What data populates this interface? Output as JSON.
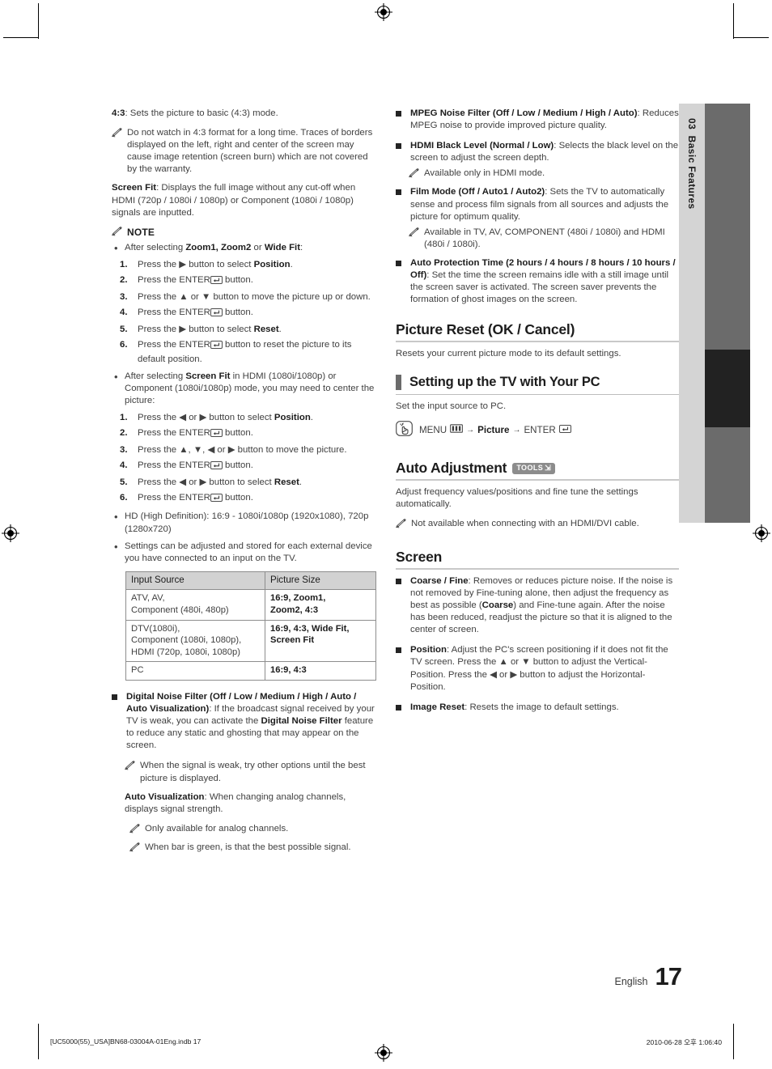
{
  "sidebar": {
    "chapter_number": "03",
    "chapter_title": "Basic Features"
  },
  "footer": {
    "language": "English",
    "page_number": "17",
    "print_file": "[UC5000(55)_USA]BN68-03004A-01Eng.indb   17",
    "print_timestamp": "2010-06-28   오후 1:06:40"
  },
  "left_column": {
    "ratio_43": {
      "term": "4:3",
      "desc": ": Sets the picture to basic (4:3) mode."
    },
    "note_43": "Do not watch in 4:3 format for a long time. Traces of borders displayed on the left, right and center of the screen may cause image retention (screen burn) which are not covered by the warranty.",
    "screen_fit": {
      "term": "Screen Fit",
      "desc": ": Displays the full image without any cut-off when HDMI (720p / 1080i / 1080p) or Component (1080i / 1080p) signals are inputted."
    },
    "note_label": "NOTE",
    "bullet1_intro_a": "After selecting ",
    "bullet1_intro_b": "Zoom1, Zoom2",
    "bullet1_intro_c": " or ",
    "bullet1_intro_d": "Wide Fit",
    "bullet1_intro_e": ":",
    "steps1": [
      {
        "num": "1.",
        "pre": "Press the ▶ button to select ",
        "bold": "Position",
        "post": "."
      },
      {
        "num": "2.",
        "pre": "Press the ENTER",
        "bold": "",
        "post": " button."
      },
      {
        "num": "3.",
        "pre": "Press the ▲ or ▼ button to move the picture up or down.",
        "bold": "",
        "post": ""
      },
      {
        "num": "4.",
        "pre": "Press the ENTER",
        "bold": "",
        "post": " button."
      },
      {
        "num": "5.",
        "pre": "Press the ▶ button to select ",
        "bold": "Reset",
        "post": "."
      },
      {
        "num": "6.",
        "pre": "Press the ENTER",
        "bold": "",
        "post": " button to reset the picture to its default position."
      }
    ],
    "bullet2_intro_a": "After selecting ",
    "bullet2_intro_b": "Screen Fit",
    "bullet2_intro_c": " in HDMI (1080i/1080p) or Component (1080i/1080p) mode, you may need to center the picture:",
    "steps2": [
      {
        "num": "1.",
        "pre": "Press the ◀ or ▶ button to select ",
        "bold": "Position",
        "post": "."
      },
      {
        "num": "2.",
        "pre": "Press the ENTER",
        "bold": "",
        "post": " button."
      },
      {
        "num": "3.",
        "pre": "Press the ▲, ▼, ◀ or ▶ button to move the picture.",
        "bold": "",
        "post": ""
      },
      {
        "num": "4.",
        "pre": "Press the ENTER",
        "bold": "",
        "post": " button."
      },
      {
        "num": "5.",
        "pre": "Press the ◀ or ▶ button to select ",
        "bold": "Reset",
        "post": "."
      },
      {
        "num": "6.",
        "pre": "Press the ENTER",
        "bold": "",
        "post": " button."
      }
    ],
    "bullet3": "HD (High Definition): 16:9 - 1080i/1080p (1920x1080), 720p (1280x720)",
    "bullet4": "Settings can be adjusted and stored for each external device you have connected to an input on the TV.",
    "table": {
      "headers": [
        "Input Source",
        "Picture Size"
      ],
      "rows": [
        {
          "source": "ATV, AV,\nComponent (480i, 480p)",
          "size": "16:9, Zoom1,\nZoom2, 4:3"
        },
        {
          "source": "DTV(1080i),\nComponent (1080i, 1080p),\nHDMI (720p, 1080i, 1080p)",
          "size": "16:9, 4:3, Wide Fit,\nScreen Fit"
        },
        {
          "source": "PC",
          "size": "16:9, 4:3"
        }
      ]
    },
    "digital_noise_filter": {
      "term": "Digital Noise Filter (Off / Low / Medium / High / Auto / Auto Visualization)",
      "desc_a": ": If the broadcast signal received by your TV is weak, you can activate the ",
      "term2": "Digital Noise Filter",
      "desc_b": " feature to reduce any static and ghosting that may appear on the screen.",
      "note": "When the signal is weak, try other options until the best picture is displayed.",
      "auto_vis_term": "Auto Visualization",
      "auto_vis_desc": ": When changing analog channels, displays signal strength.",
      "note2": "Only available for analog channels.",
      "note3": "When bar is green, is that the best possible signal."
    }
  },
  "right_column": {
    "mpeg_noise_filter": {
      "term": "MPEG Noise Filter (Off / Low / Medium / High / Auto)",
      "desc": ": Reduces MPEG noise to provide improved picture quality."
    },
    "hdmi_black_level": {
      "term": "HDMI Black Level (Normal / Low)",
      "desc": ": Selects the black level on the screen to adjust the screen depth.",
      "note": "Available only in HDMI mode."
    },
    "film_mode": {
      "term": "Film Mode (Off / Auto1 / Auto2)",
      "desc": ": Sets the TV to automatically sense and process film signals from all sources and adjusts the picture for optimum quality.",
      "note": "Available in TV, AV, COMPONENT (480i / 1080i) and HDMI (480i / 1080i)."
    },
    "auto_protection_time": {
      "term": "Auto Protection Time (2 hours / 4 hours / 8 hours / 10 hours / Off)",
      "desc": ": Set the time the screen remains idle with a still image until the screen saver is activated. The screen saver prevents the formation of ghost images on the screen."
    },
    "picture_reset": {
      "heading": "Picture Reset (OK / Cancel)",
      "body": "Resets your current picture mode to its default settings."
    },
    "setting_up_pc": {
      "heading": "Setting up the TV with Your PC",
      "body": "Set the input source to PC.",
      "menu_path": {
        "menu_label": "MENU",
        "arrow": "→",
        "picture_label": "Picture",
        "enter_label": "ENTER"
      }
    },
    "auto_adjustment": {
      "heading": "Auto Adjustment",
      "badge": "TOOLS",
      "body": "Adjust frequency values/positions and fine tune the settings automatically.",
      "note": "Not available when connecting with an HDMI/DVI cable."
    },
    "screen": {
      "heading": "Screen",
      "coarse_fine": {
        "term": "Coarse / Fine",
        "desc_a": ": Removes or reduces picture noise. If the noise is not removed by Fine-tuning alone, then adjust the frequency as best as possible (",
        "term2": "Coarse",
        "desc_b": ") and Fine-tune again. After the noise has been reduced, readjust the picture so that it is aligned to the center of screen."
      },
      "position": {
        "term": "Position",
        "desc": ": Adjust the PC's screen positioning if it does not fit the TV screen. Press the ▲ or ▼ button to adjust the Vertical-Position. Press the ◀ or ▶ button to adjust the Horizontal-Position."
      },
      "image_reset": {
        "term": "Image Reset",
        "desc": ": Resets the image to default settings."
      }
    }
  },
  "colors": {
    "tab_light": "#d4d4d4",
    "tab_dark": "#6b6b6b",
    "tab_black": "#222222",
    "rule": "#c9c9c9",
    "table_header": "#d2d2d2"
  }
}
